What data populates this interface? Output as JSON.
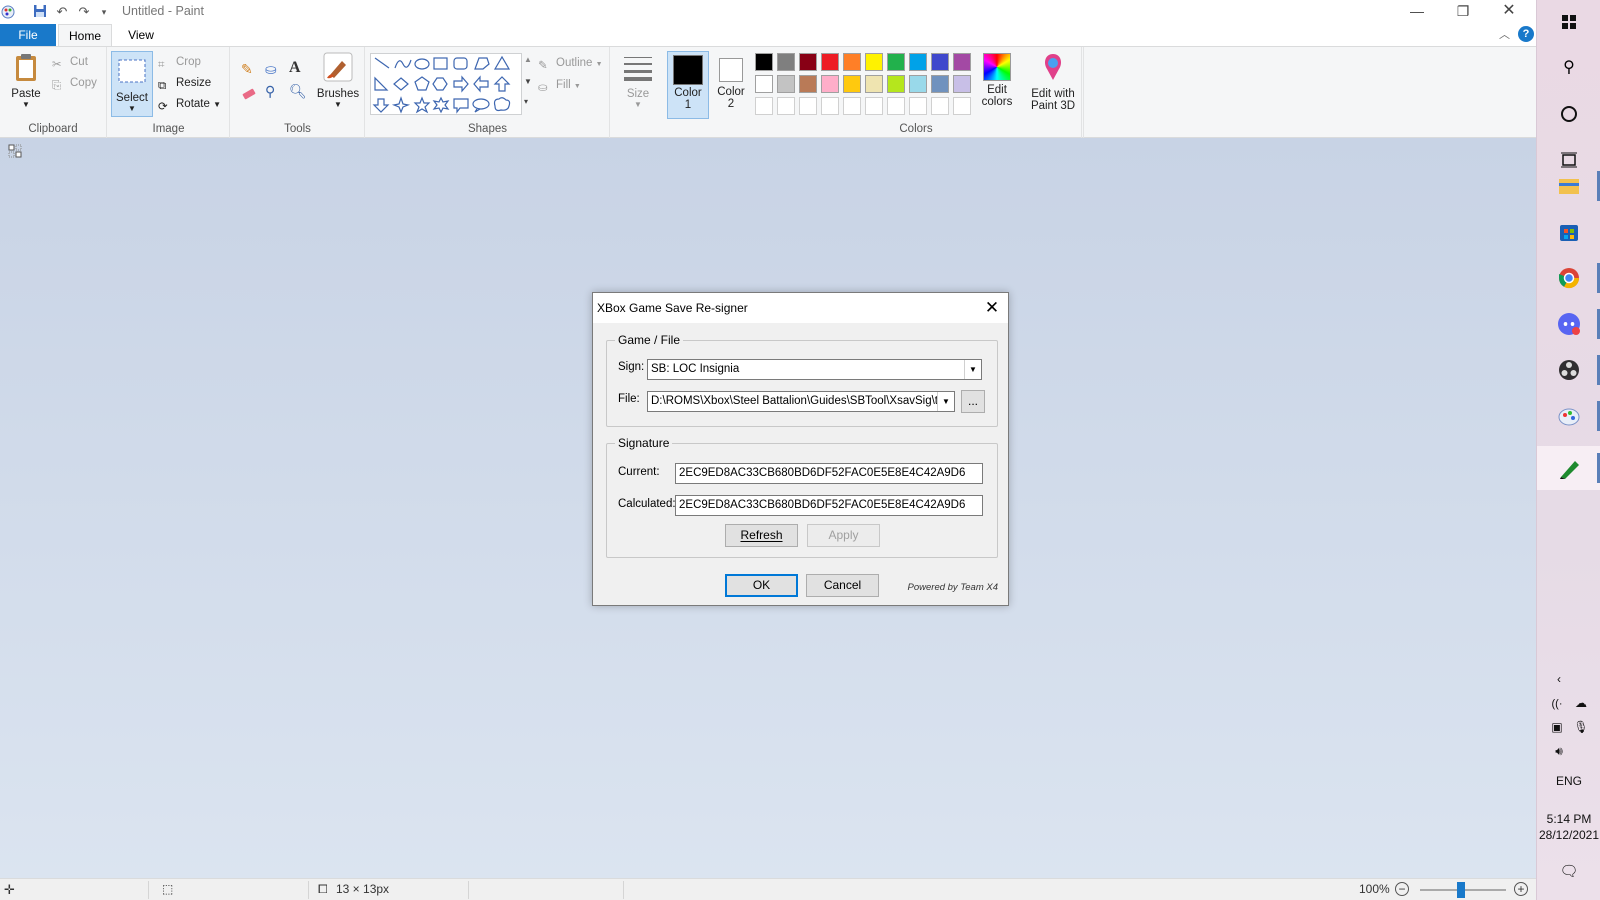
{
  "window": {
    "title": "Untitled - Paint"
  },
  "tabs": {
    "file": "File",
    "home": "Home",
    "view": "View"
  },
  "ribbon": {
    "clipboard": {
      "paste": "Paste",
      "cut": "Cut",
      "copy": "Copy",
      "label": "Clipboard"
    },
    "image": {
      "select": "Select",
      "crop": "Crop",
      "resize": "Resize",
      "rotate": "Rotate",
      "label": "Image"
    },
    "tools": {
      "label": "Tools"
    },
    "brushes": "Brushes",
    "shapes": {
      "outline": "Outline",
      "fill": "Fill",
      "label": "Shapes"
    },
    "size": "Size",
    "color1": [
      "Color",
      "1"
    ],
    "color2": [
      "Color",
      "2"
    ],
    "colors": {
      "label": "Colors",
      "row1": [
        "#000000",
        "#7f7f7f",
        "#880015",
        "#ed1c24",
        "#ff7f27",
        "#fff200",
        "#22b14c",
        "#00a2e8",
        "#3f48cc",
        "#a349a4"
      ],
      "row2": [
        "#ffffff",
        "#c3c3c3",
        "#b97a57",
        "#ffaec9",
        "#ffc90e",
        "#efe4b0",
        "#b5e61d",
        "#99d9ea",
        "#7092be",
        "#c8bfe7"
      ]
    },
    "edit_colors": [
      "Edit",
      "colors"
    ],
    "paint3d": [
      "Edit with",
      "Paint 3D"
    ]
  },
  "status": {
    "dimensions": "13 × 13px",
    "zoom": "100%"
  },
  "dialog": {
    "title": "XBox Game Save Re-signer",
    "game_group": "Game / File",
    "sign_label": "Sign:",
    "sign_value": "SB: LOC Insignia",
    "file_label": "File:",
    "file_value": "D:\\ROMS\\Xbox\\Steel Battalion\\Guides\\SBTool\\XsavSig\\te",
    "browse": "...",
    "sig_group": "Signature",
    "current_label": "Current:",
    "current_value": "2EC9ED8AC33CB680BD6DF52FAC0E5E8E4C42A9D6",
    "calc_label": "Calculated:",
    "calc_value": "2EC9ED8AC33CB680BD6DF52FAC0E5E8E4C42A9D6",
    "refresh": "Refresh",
    "apply": "Apply",
    "ok": "OK",
    "cancel": "Cancel",
    "powered": "Powered by Team X4"
  },
  "taskbar": {
    "lang": "ENG",
    "time": "5:14 PM",
    "date": "28/12/2021"
  }
}
